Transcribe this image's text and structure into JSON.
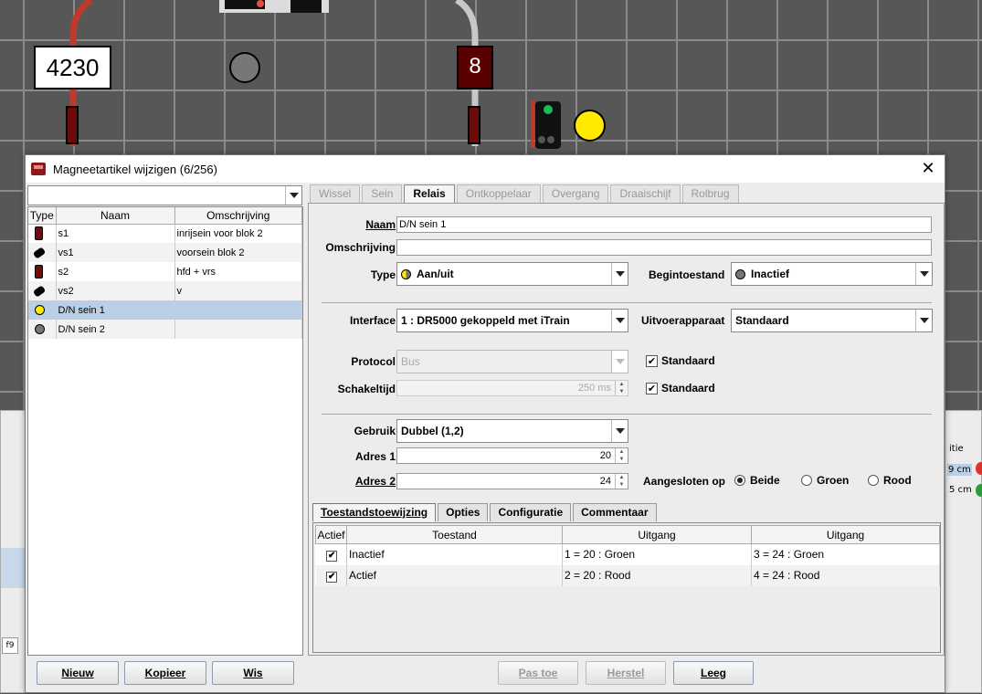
{
  "layout": {
    "block_label": "4230",
    "signal_label": "8"
  },
  "background": {
    "fragments": [
      "itie",
      "9 cm",
      "5 cm",
      "f9"
    ]
  },
  "dialog": {
    "title": "Magneetartikel wijzigen (6/256)",
    "close_glyph": "✕",
    "left": {
      "search_value": "",
      "columns": [
        "Type",
        "Naam",
        "Omschrijving"
      ],
      "rows": [
        {
          "type_icon": "signal-icon",
          "name": "s1",
          "description": "inrijsein voor blok 2"
        },
        {
          "type_icon": "presignal-icon",
          "name": "vs1",
          "description": "voorsein blok 2"
        },
        {
          "type_icon": "signal-icon",
          "name": "s2",
          "description": "hfd + vrs"
        },
        {
          "type_icon": "presignal-icon",
          "name": "vs2",
          "description": "v"
        },
        {
          "type_icon": "yellow-light-icon",
          "name": "D/N sein 1",
          "description": ""
        },
        {
          "type_icon": "grey-light-icon",
          "name": "D/N sein 2",
          "description": ""
        }
      ],
      "buttons": {
        "new": "Nieuw",
        "copy": "Kopieer",
        "delete": "Wis"
      }
    },
    "tabs": [
      "Wissel",
      "Sein",
      "Relais",
      "Ontkoppelaar",
      "Overgang",
      "Draaischijf",
      "Rolbrug"
    ],
    "active_tab": "Relais",
    "form": {
      "name_label": "Naam",
      "name_value": "D/N sein 1",
      "description_label": "Omschrijving",
      "description_value": "",
      "type_label": "Type",
      "type_value": "Aan/uit",
      "initial_state_label": "Begintoestand",
      "initial_state_value": "Inactief",
      "interface_label": "Interface",
      "interface_value": "1 : DR5000 gekoppeld met iTrain",
      "output_device_label": "Uitvoerapparaat",
      "output_device_value": "Standaard",
      "protocol_label": "Protocol",
      "protocol_value": "Bus",
      "protocol_standard_label": "Standaard",
      "protocol_standard_checked": "✔",
      "switch_time_label": "Schakeltijd",
      "switch_time_value": "250 ms",
      "switch_time_standard_label": "Standaard",
      "switch_time_standard_checked": "✔",
      "usage_label": "Gebruik",
      "usage_value": "Dubbel (1,2)",
      "address1_label": "Adres 1",
      "address1_value": "20",
      "address2_label": "Adres 2",
      "address2_value": "24",
      "connected_label": "Aangesloten op",
      "connected_options": [
        "Beide",
        "Groen",
        "Rood"
      ],
      "connected_selected": "Beide"
    },
    "subtabs": [
      "Toestandstoewijzing",
      "Opties",
      "Configuratie",
      "Commentaar"
    ],
    "active_subtab": "Toestandstoewijzing",
    "state_table": {
      "columns": [
        "Actief",
        "Toestand",
        "Uitgang",
        "Uitgang"
      ],
      "rows": [
        {
          "active": "✔",
          "state": "Inactief",
          "output1": "1 = 20 : Groen",
          "output2": "3 = 24 : Groen"
        },
        {
          "active": "✔",
          "state": "Actief",
          "output1": "2 = 20 : Rood",
          "output2": "4 = 24 : Rood"
        }
      ]
    },
    "bottom_buttons": {
      "apply": "Pas toe",
      "restore": "Herstel",
      "clear": "Leeg"
    }
  },
  "colors": {
    "track_red": "#c0392b",
    "occupied_dark_red": "#6d0a0a",
    "lamp_yellow": "#ffea00",
    "lamp_grey": "#777777",
    "selection": "#b8cfe5"
  }
}
